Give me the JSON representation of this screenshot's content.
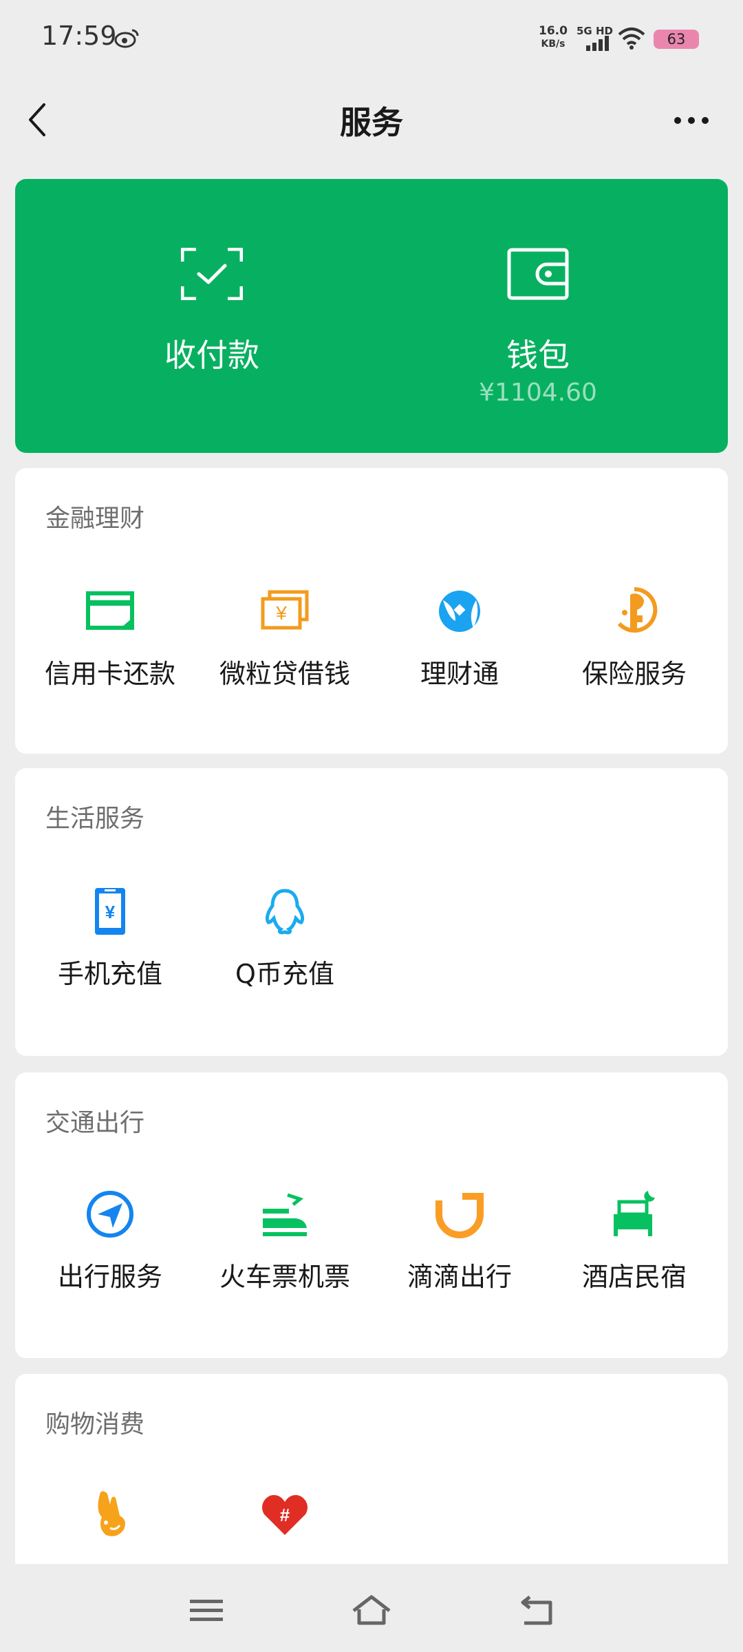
{
  "status_bar": {
    "time": "17:59",
    "net_speed_value": "16.0",
    "net_speed_unit": "KB/s",
    "network": "5G HD",
    "battery": "63"
  },
  "header": {
    "title": "服务"
  },
  "hero": {
    "pay": {
      "label": "收付款"
    },
    "wallet": {
      "label": "钱包",
      "balance": "¥1104.60"
    }
  },
  "sections": {
    "finance": {
      "title": "金融理财",
      "items": [
        {
          "label": "信用卡还款",
          "icon": "credit-card-icon",
          "color": "#07c160"
        },
        {
          "label": "微粒贷借钱",
          "icon": "loan-icon",
          "color": "#f39b1e"
        },
        {
          "label": "理财通",
          "icon": "wealth-icon",
          "color": "#1aa3f0"
        },
        {
          "label": "保险服务",
          "icon": "insurance-icon",
          "color": "#f39b1e"
        }
      ]
    },
    "life": {
      "title": "生活服务",
      "items": [
        {
          "label": "手机充值",
          "icon": "phone-recharge-icon",
          "color": "#1485ee"
        },
        {
          "label": "Q币充值",
          "icon": "qq-penguin-icon",
          "color": "#1aabee"
        }
      ]
    },
    "travel": {
      "title": "交通出行",
      "items": [
        {
          "label": "出行服务",
          "icon": "navigation-icon",
          "color": "#1485ee"
        },
        {
          "label": "火车票机票",
          "icon": "train-plane-icon",
          "color": "#07c160"
        },
        {
          "label": "滴滴出行",
          "icon": "didi-icon",
          "color": "#fa9d24"
        },
        {
          "label": "酒店民宿",
          "icon": "hotel-bed-icon",
          "color": "#07c160"
        }
      ]
    },
    "shopping": {
      "title": "购物消费",
      "items": [
        {
          "label": "",
          "icon": "rabbit-icon",
          "color": "#f7a21b"
        },
        {
          "label": "",
          "icon": "pinduoduo-icon",
          "color": "#e02e24"
        }
      ]
    }
  },
  "nav_bar": {
    "buttons": [
      "menu-icon",
      "home-icon",
      "back-icon"
    ]
  }
}
